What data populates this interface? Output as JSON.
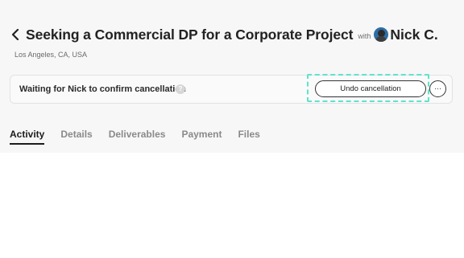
{
  "header": {
    "title": "Seeking a Commercial DP for a Corporate Project",
    "with_label": "with",
    "person_name": "Nick C.",
    "location": "Los Angeles, CA, USA"
  },
  "status": {
    "message": "Waiting for Nick to confirm cancellation",
    "help_glyph": "?",
    "undo_label": "Undo cancellation",
    "more_label": "···"
  },
  "tabs": [
    {
      "label": "Activity",
      "active": true
    },
    {
      "label": "Details",
      "active": false
    },
    {
      "label": "Deliverables",
      "active": false
    },
    {
      "label": "Payment",
      "active": false
    },
    {
      "label": "Files",
      "active": false
    }
  ],
  "colors": {
    "highlight": "#5ee3cf",
    "panel_bg": "#f7f7f7"
  }
}
